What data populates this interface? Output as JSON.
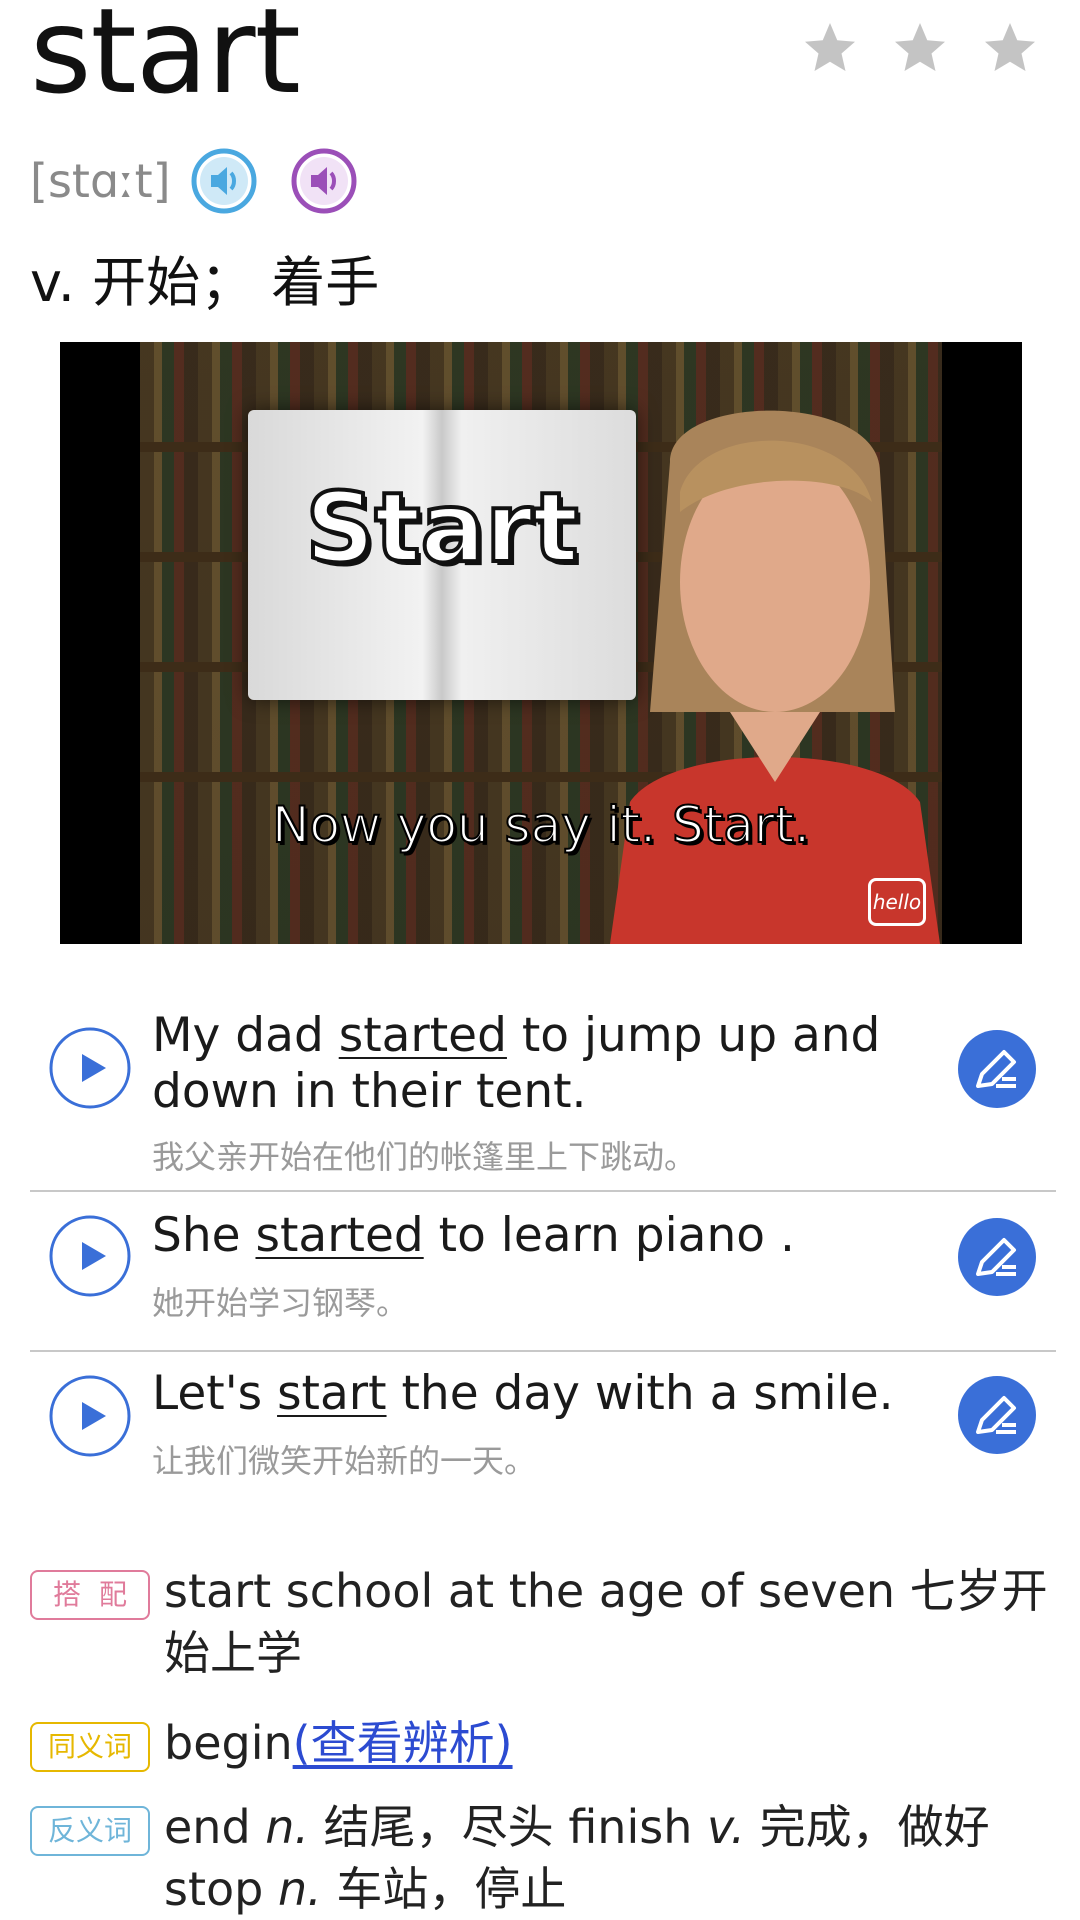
{
  "word": "start",
  "stars": [
    "star-icon",
    "star-icon",
    "star-icon"
  ],
  "phonetic": "[stɑːt]",
  "definition": "v. 开始；  着手",
  "video": {
    "book_title": "Start",
    "subtitle": "Now you say it.  Start.",
    "logo": "hello"
  },
  "examples": [
    {
      "en_before": "My dad ",
      "en_word": "started",
      "en_after": " to jump up and down in their tent.",
      "zh": "我父亲开始在他们的帐篷里上下跳动。"
    },
    {
      "en_before": "She ",
      "en_word": "started",
      "en_after": " to learn piano .",
      "zh": "她开始学习钢琴。"
    },
    {
      "en_before": "Let's ",
      "en_word": "start",
      "en_after": " the day with a smile.",
      "zh": "让我们微笑开始新的一天。"
    }
  ],
  "collocation": {
    "tag": "搭配",
    "text": "start school at the age of seven 七岁开始上学"
  },
  "synonym": {
    "tag": "同义词",
    "word": "begin",
    "link": "(查看辨析)"
  },
  "antonym": {
    "tag": "反义词",
    "w1": "end ",
    "p1": "n.",
    "m1": " 结尾，尽头 ",
    "w2": "finish ",
    "p2": "v.",
    "m2": " 完成，做好",
    "w3": "stop ",
    "p3": "n.",
    "m3": " 车站，停止"
  },
  "colors": {
    "icon_blue": "#3a6fd8",
    "speaker_blue": "#4aa8e0",
    "speaker_purple": "#9b4fb8",
    "star_gray": "#c4c4c4"
  }
}
